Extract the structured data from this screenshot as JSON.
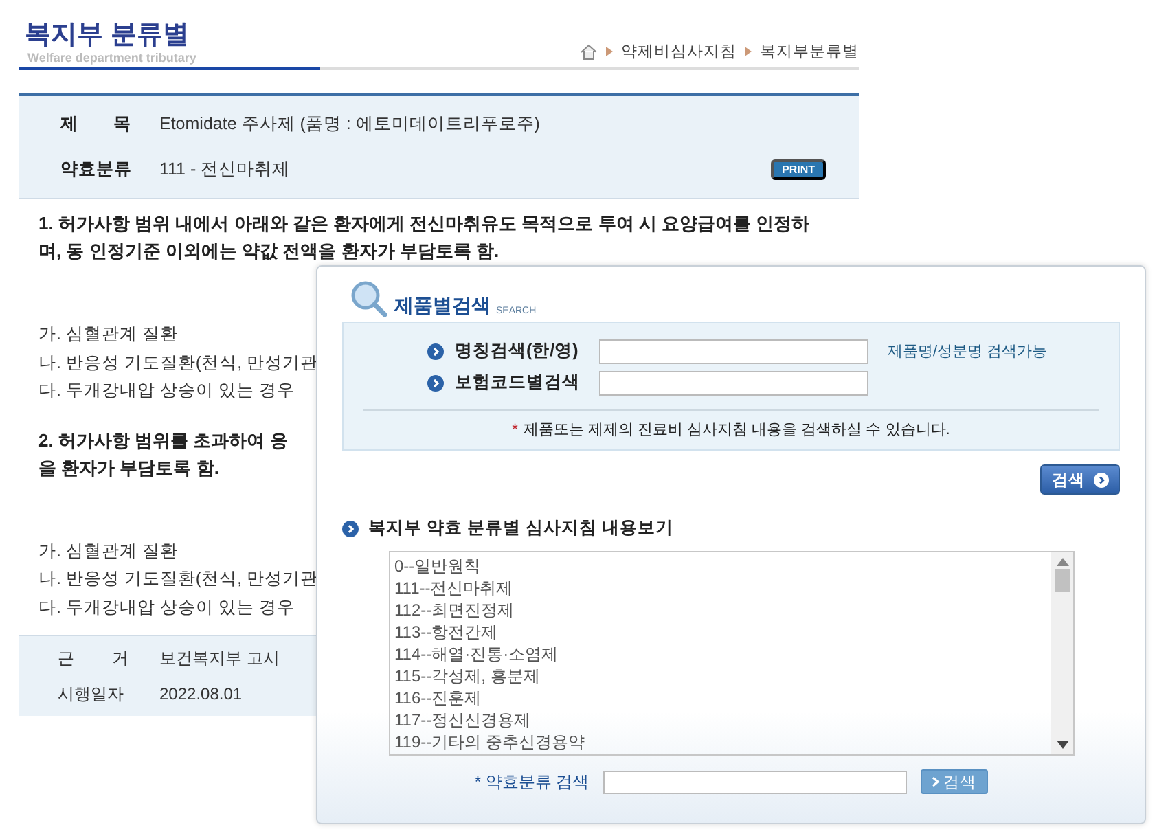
{
  "header": {
    "title": "복지부 분류별",
    "subtitle": "Welfare  department tributary",
    "breadcrumb": [
      "약제비심사지침",
      "복지부분류별"
    ]
  },
  "info": [
    {
      "label": "제 목",
      "value": "Etomidate 주사제 (품명 : 에토미데이트리푸로주)"
    },
    {
      "label": "약효분류",
      "value": "111 - 전신마취제",
      "badge": "PRINT"
    }
  ],
  "body": [
    {
      "kind": "para",
      "lines": [
        "1. 허가사항 범위 내에서 아래와 같은 환자에게 전신마취유도 목적으로 투여 시 요양급여를 인정하",
        "며, 동 인정기준 이외에는 약값 전액을 환자가 부담토록 함."
      ]
    },
    {
      "kind": "list",
      "items": [
        "가. 심혈관계 질환",
        "나. 반응성 기도질환(천식, 만성기관",
        "다. 두개강내압 상승이 있는 경우"
      ]
    },
    {
      "kind": "para",
      "lines": [
        "2. 허가사항 범위를 초과하여 응",
        "을 환자가 부담토록 함."
      ]
    },
    {
      "kind": "list",
      "items": [
        "가. 심혈관계 질환",
        "나. 반응성 기도질환(천식, 만성기관",
        "다. 두개강내압 상승이 있는 경우"
      ]
    }
  ],
  "footer_info": [
    {
      "label": "근 거",
      "value": "보건복지부 고시"
    },
    {
      "label": "시행일자",
      "value": "2022.08.01"
    }
  ],
  "popup": {
    "title": "제품별검색",
    "title_tag": "SEARCH",
    "fields": [
      {
        "label": "명칭검색(한/영)",
        "hint": "제품명/성분명 검색가능"
      },
      {
        "label": "보험코드별검색"
      }
    ],
    "note_mark": "*",
    "note": "제품또는 제제의 진료비 심사지침 내용을 검색하실 수 있습니다.",
    "search_button": "검색",
    "section_title": "복지부 약효 분류별 심사지침 내용보기",
    "classes": [
      "0--일반원칙",
      "111--전신마취제",
      "112--최면진정제",
      "113--항전간제",
      "114--해열·진통·소염제",
      "115--각성제, 흥분제",
      "116--진훈제",
      "117--정신신경용제",
      "119--기타의 중추신경용약"
    ],
    "class_search_label": "* 약효분류 검색",
    "class_search_button": "검색"
  }
}
